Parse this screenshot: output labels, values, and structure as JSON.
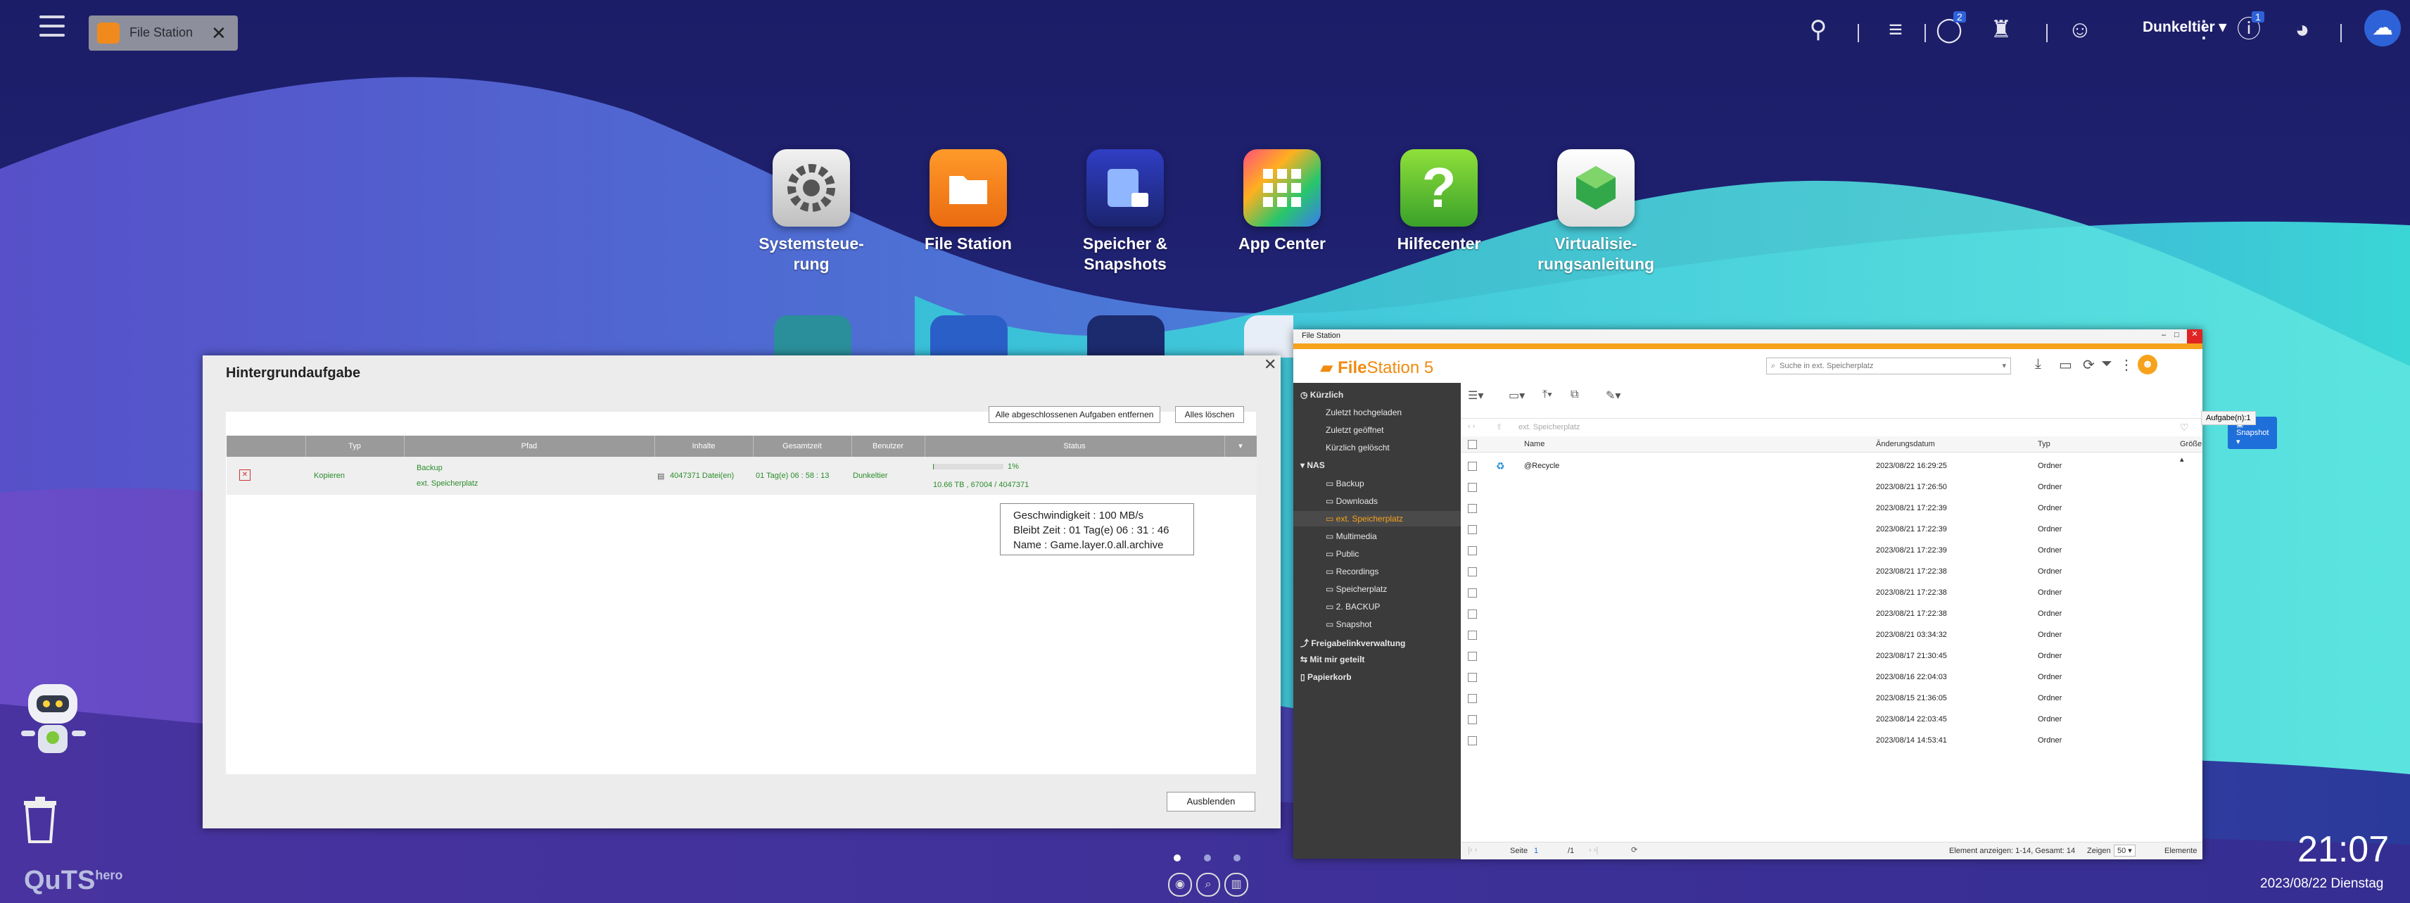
{
  "taskbar": {
    "open_app": "File Station",
    "user_name": "Dunkeltier",
    "badge_tasks": "2",
    "badge_info": "1"
  },
  "apps": [
    {
      "name_line1": "Systemsteue-",
      "name_line2": "rung",
      "icon": "gear-icon"
    },
    {
      "name_line1": "File Station",
      "name_line2": "",
      "icon": "folder-icon"
    },
    {
      "name_line1": "Speicher &",
      "name_line2": "Snapshots",
      "icon": "storage-icon"
    },
    {
      "name_line1": "App Center",
      "name_line2": "",
      "icon": "grid-icon"
    },
    {
      "name_line1": "Hilfecenter",
      "name_line2": "",
      "icon": "question-icon"
    },
    {
      "name_line1": "Virtualisie-",
      "name_line2": "rungsanleitung",
      "icon": "cube-icon"
    }
  ],
  "bg_task": {
    "title": "Hintergrundaufgabe",
    "btn_remove_done": "Alle abgeschlossenen Aufgaben entfernen",
    "btn_delete_all": "Alles löschen",
    "columns": [
      "Typ",
      "Pfad",
      "Inhalte",
      "Gesamtzeit",
      "Benutzer",
      "Status"
    ],
    "row": {
      "type": "Kopieren",
      "path_from": "Backup",
      "path_to": "ext. Speicherplatz",
      "content": "4047371 Datei(en)",
      "total_time": "01 Tag(e) 06 : 58 : 13",
      "user": "Dunkeltier",
      "progress_pct": "1%",
      "progress_fraction": 0.01,
      "status_detail": "10.66 TB , 67004 / 4047371"
    },
    "tooltip": {
      "speed": "Geschwindigkeit :  100 MB/s",
      "remaining": "Bleibt Zeit : 01 Tag(e) 06 : 31 : 46",
      "name": "Name : Game.layer.0.all.archive"
    },
    "btn_hide": "Ausblenden"
  },
  "file_station": {
    "window_title": "File Station",
    "brand_a": "File",
    "brand_b": "Station 5",
    "search_placeholder": "Suche in ext. Speicherplatz",
    "tasks_tooltip": "Aufgabe(n):1",
    "snapshot_btn": "Snapshot",
    "breadcrumb": "ext. Speicherplatz",
    "sidebar": {
      "recent": "Kürzlich",
      "recent_items": [
        "Zuletzt hochgeladen",
        "Zuletzt geöffnet",
        "Kürzlich gelöscht"
      ],
      "nas": "NAS",
      "folders": [
        "Backup",
        "Downloads",
        "ext. Speicherplatz",
        "Multimedia",
        "Public",
        "Recordings",
        "Speicherplatz",
        "2. BACKUP",
        "Snapshot"
      ],
      "share_links": "Freigabelinkverwaltung",
      "shared_with_me": "Mit mir geteilt",
      "recycle": "Papierkorb"
    },
    "columns": {
      "name": "Name",
      "date": "Änderungsdatum",
      "type": "Typ",
      "size": "Größe"
    },
    "rows": [
      {
        "name": "@Recycle",
        "date": "2023/08/22 16:29:25",
        "type": "Ordner"
      },
      {
        "name": "",
        "date": "2023/08/21 17:26:50",
        "type": "Ordner"
      },
      {
        "name": "",
        "date": "2023/08/21 17:22:39",
        "type": "Ordner"
      },
      {
        "name": "",
        "date": "2023/08/21 17:22:39",
        "type": "Ordner"
      },
      {
        "name": "",
        "date": "2023/08/21 17:22:39",
        "type": "Ordner"
      },
      {
        "name": "",
        "date": "2023/08/21 17:22:38",
        "type": "Ordner"
      },
      {
        "name": "",
        "date": "2023/08/21 17:22:38",
        "type": "Ordner"
      },
      {
        "name": "",
        "date": "2023/08/21 17:22:38",
        "type": "Ordner"
      },
      {
        "name": "",
        "date": "2023/08/21 03:34:32",
        "type": "Ordner"
      },
      {
        "name": "",
        "date": "2023/08/17 21:30:45",
        "type": "Ordner"
      },
      {
        "name": "",
        "date": "2023/08/16 22:04:03",
        "type": "Ordner"
      },
      {
        "name": "",
        "date": "2023/08/15 21:36:05",
        "type": "Ordner"
      },
      {
        "name": "",
        "date": "2023/08/14 22:03:45",
        "type": "Ordner"
      },
      {
        "name": "",
        "date": "2023/08/14 14:53:41",
        "type": "Ordner"
      }
    ],
    "footer": {
      "page_label": "Seite",
      "page_value": "1",
      "page_total": "/1",
      "count_text": "Element anzeigen: 1-14, Gesamt: 14",
      "show_label": "Zeigen",
      "show_value": "50",
      "items_label": "Elemente"
    }
  },
  "clock": {
    "time": "21:07",
    "date": "2023/08/22 Dienstag"
  },
  "brand": {
    "logo": "QuTS",
    "logo_sup": "hero"
  }
}
